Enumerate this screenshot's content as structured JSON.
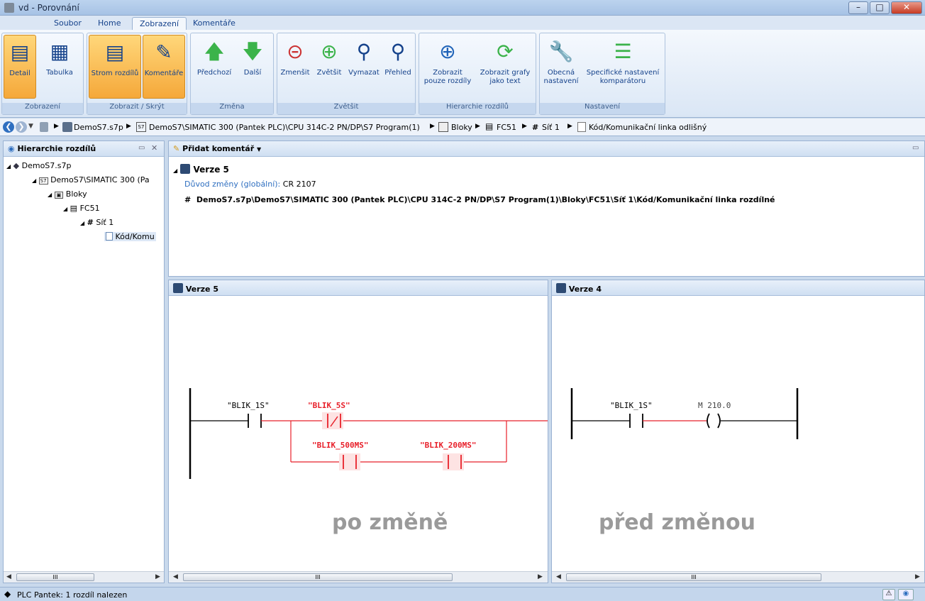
{
  "window": {
    "title": "vd - Porovnání"
  },
  "menu_tabs": [
    "Soubor",
    "Home",
    "Zobrazení",
    "Komentáře"
  ],
  "ribbon": {
    "groups": {
      "zobrazeni": "Zobrazení",
      "zobrazit_skryt": "Zobrazit / Skrýt",
      "zmena": "Změna",
      "zvetsit": "Zvětšit",
      "hierarchie": "Hierarchie rozdílů",
      "nastaveni": "Nastavení"
    },
    "buttons": {
      "detail": "Detail",
      "tabulka": "Tabulka",
      "strom": "Strom rozdílů",
      "komentare": "Komentáře",
      "predchozi": "Předchozí",
      "dalsi": "Další",
      "zmensit": "Zmenšit",
      "zvetsit": "Zvětšit",
      "vymazat": "Vymazat",
      "prehled": "Přehled",
      "zobrazit_pouze_1": "Zobrazit",
      "zobrazit_pouze_2": "pouze rozdíly",
      "zobrazit_grafy_1": "Zobrazit grafy",
      "zobrazit_grafy_2": "jako text",
      "obecna_1": "Obecná",
      "obecna_2": "nastavení",
      "specificke_1": "Specifické nastavení",
      "specificke_2": "komparátoru"
    }
  },
  "breadcrumb": [
    "DemoS7.s7p",
    "DemoS7\\SIMATIC 300 (Pantek PLC)\\CPU 314C-2 PN/DP\\S7 Program(1)",
    "Bloky",
    "FC51",
    "Síť 1",
    "Kód/Komunikační linka odlišný"
  ],
  "left_pane": {
    "title": "Hierarchie rozdílů",
    "tree": [
      "DemoS7.s7p",
      "DemoS7\\SIMATIC 300 (Pa",
      "Bloky",
      "FC51",
      "Síť 1",
      "Kód/Komu"
    ],
    "scroll_label": "III"
  },
  "top_pane": {
    "toolbar_label": "Přidat komentář",
    "version": "Verze 5",
    "reason_label": "Důvod změny (globální):",
    "reason_value": "CR 2107",
    "path": "DemoS7.s7p\\DemoS7\\SIMATIC 300 (Pantek PLC)\\CPU 314C-2 PN/DP\\S7 Program(1)\\Bloky\\FC51\\Síť  1\\Kód/Komunikační linka rozdílné"
  },
  "left_ladder": {
    "header": "Verze 5",
    "contact1": "\"BLIK_1S\"",
    "contact2": "\"BLIK_5S\"",
    "contact3": "\"BLIK_500MS\"",
    "contact4": "\"BLIK_200MS\"",
    "caption": "po změně",
    "scroll_label": "III"
  },
  "right_ladder": {
    "header": "Verze 4",
    "contact1": "\"BLIK_1S\"",
    "coil": "M 210.0",
    "caption": "před změnou",
    "scroll_label": "III"
  },
  "status": {
    "text": "PLC Pantek: 1 rozdíl nalezen"
  },
  "colors": {
    "diff_red": "#e8202a",
    "accent": "#f5a83a"
  }
}
